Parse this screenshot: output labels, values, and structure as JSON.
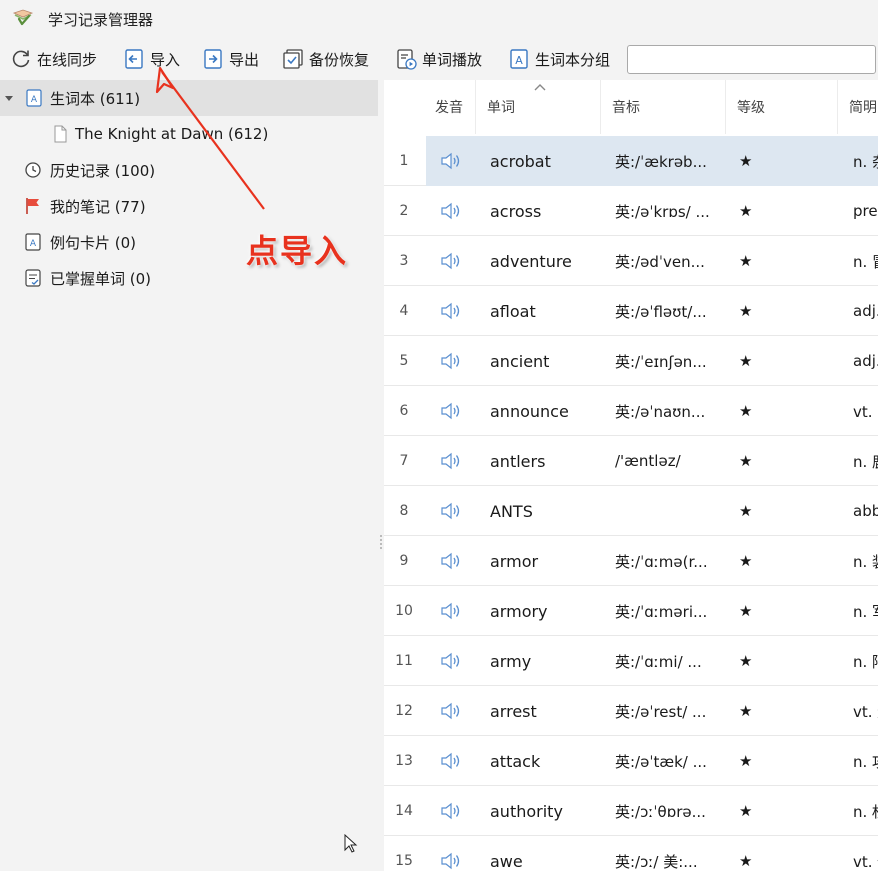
{
  "window": {
    "title": "学习记录管理器"
  },
  "toolbar": {
    "sync_label": "在线同步",
    "import_label": "导入",
    "export_label": "导出",
    "backup_label": "备份恢复",
    "playback_label": "单词播放",
    "group_label": "生词本分组",
    "search_value": ""
  },
  "sidebar": {
    "items": [
      {
        "label": "生词本 (611)"
      },
      {
        "label": "The Knight at Dawn (612)"
      },
      {
        "label": "历史记录 (100)"
      },
      {
        "label": "我的笔记 (77)"
      },
      {
        "label": "例句卡片 (0)"
      },
      {
        "label": "已掌握单词 (0)"
      }
    ]
  },
  "table": {
    "columns": [
      "发音",
      "单词",
      "音标",
      "等级",
      "简明"
    ],
    "rows": [
      {
        "n": "1",
        "word": "acrobat",
        "phon": "英:/ˈækrəb...",
        "lvl": "★",
        "mean": "n. 杂"
      },
      {
        "n": "2",
        "word": "across",
        "phon": "英:/əˈkrɒs/ ...",
        "lvl": "★",
        "mean": "prep"
      },
      {
        "n": "3",
        "word": "adventure",
        "phon": "英:/ədˈven...",
        "lvl": "★",
        "mean": "n. 冒"
      },
      {
        "n": "4",
        "word": "afloat",
        "phon": "英:/əˈfləʊt/...",
        "lvl": "★",
        "mean": "adj."
      },
      {
        "n": "5",
        "word": "ancient",
        "phon": "英:/ˈeɪnʃən...",
        "lvl": "★",
        "mean": "adj."
      },
      {
        "n": "6",
        "word": "announce",
        "phon": "英:/əˈnaʊn...",
        "lvl": "★",
        "mean": "vt. 宣"
      },
      {
        "n": "7",
        "word": "antlers",
        "phon": "/'æntləz/",
        "lvl": "★",
        "mean": "n. 鹿"
      },
      {
        "n": "8",
        "word": "ANTS",
        "phon": "",
        "lvl": "★",
        "mean": "abbr"
      },
      {
        "n": "9",
        "word": "armor",
        "phon": "英:/ˈɑːmə(r...",
        "lvl": "★",
        "mean": "n. 装"
      },
      {
        "n": "10",
        "word": "armory",
        "phon": "英:/ˈɑːməri...",
        "lvl": "★",
        "mean": "n. 军"
      },
      {
        "n": "11",
        "word": "army",
        "phon": "英:/ˈɑːmi/  ...",
        "lvl": "★",
        "mean": "n. 陆"
      },
      {
        "n": "12",
        "word": "arrest",
        "phon": "英:/əˈrest/ ...",
        "lvl": "★",
        "mean": "vt. 逮"
      },
      {
        "n": "13",
        "word": "attack",
        "phon": "英:/əˈtæk/ ...",
        "lvl": "★",
        "mean": "n. 攻"
      },
      {
        "n": "14",
        "word": "authority",
        "phon": "英:/ɔːˈθɒrə...",
        "lvl": "★",
        "mean": "n. 权"
      },
      {
        "n": "15",
        "word": "awe",
        "phon": "英:/ɔː/   美:...",
        "lvl": "★",
        "mean": "vt. 使"
      }
    ]
  },
  "annotation": {
    "text": "点导入",
    "color": "#e8321e"
  },
  "colors": {
    "accent": "#2d7dd2",
    "selected_row": "#dde7f1",
    "tree_selected": "#e1e1e1"
  }
}
